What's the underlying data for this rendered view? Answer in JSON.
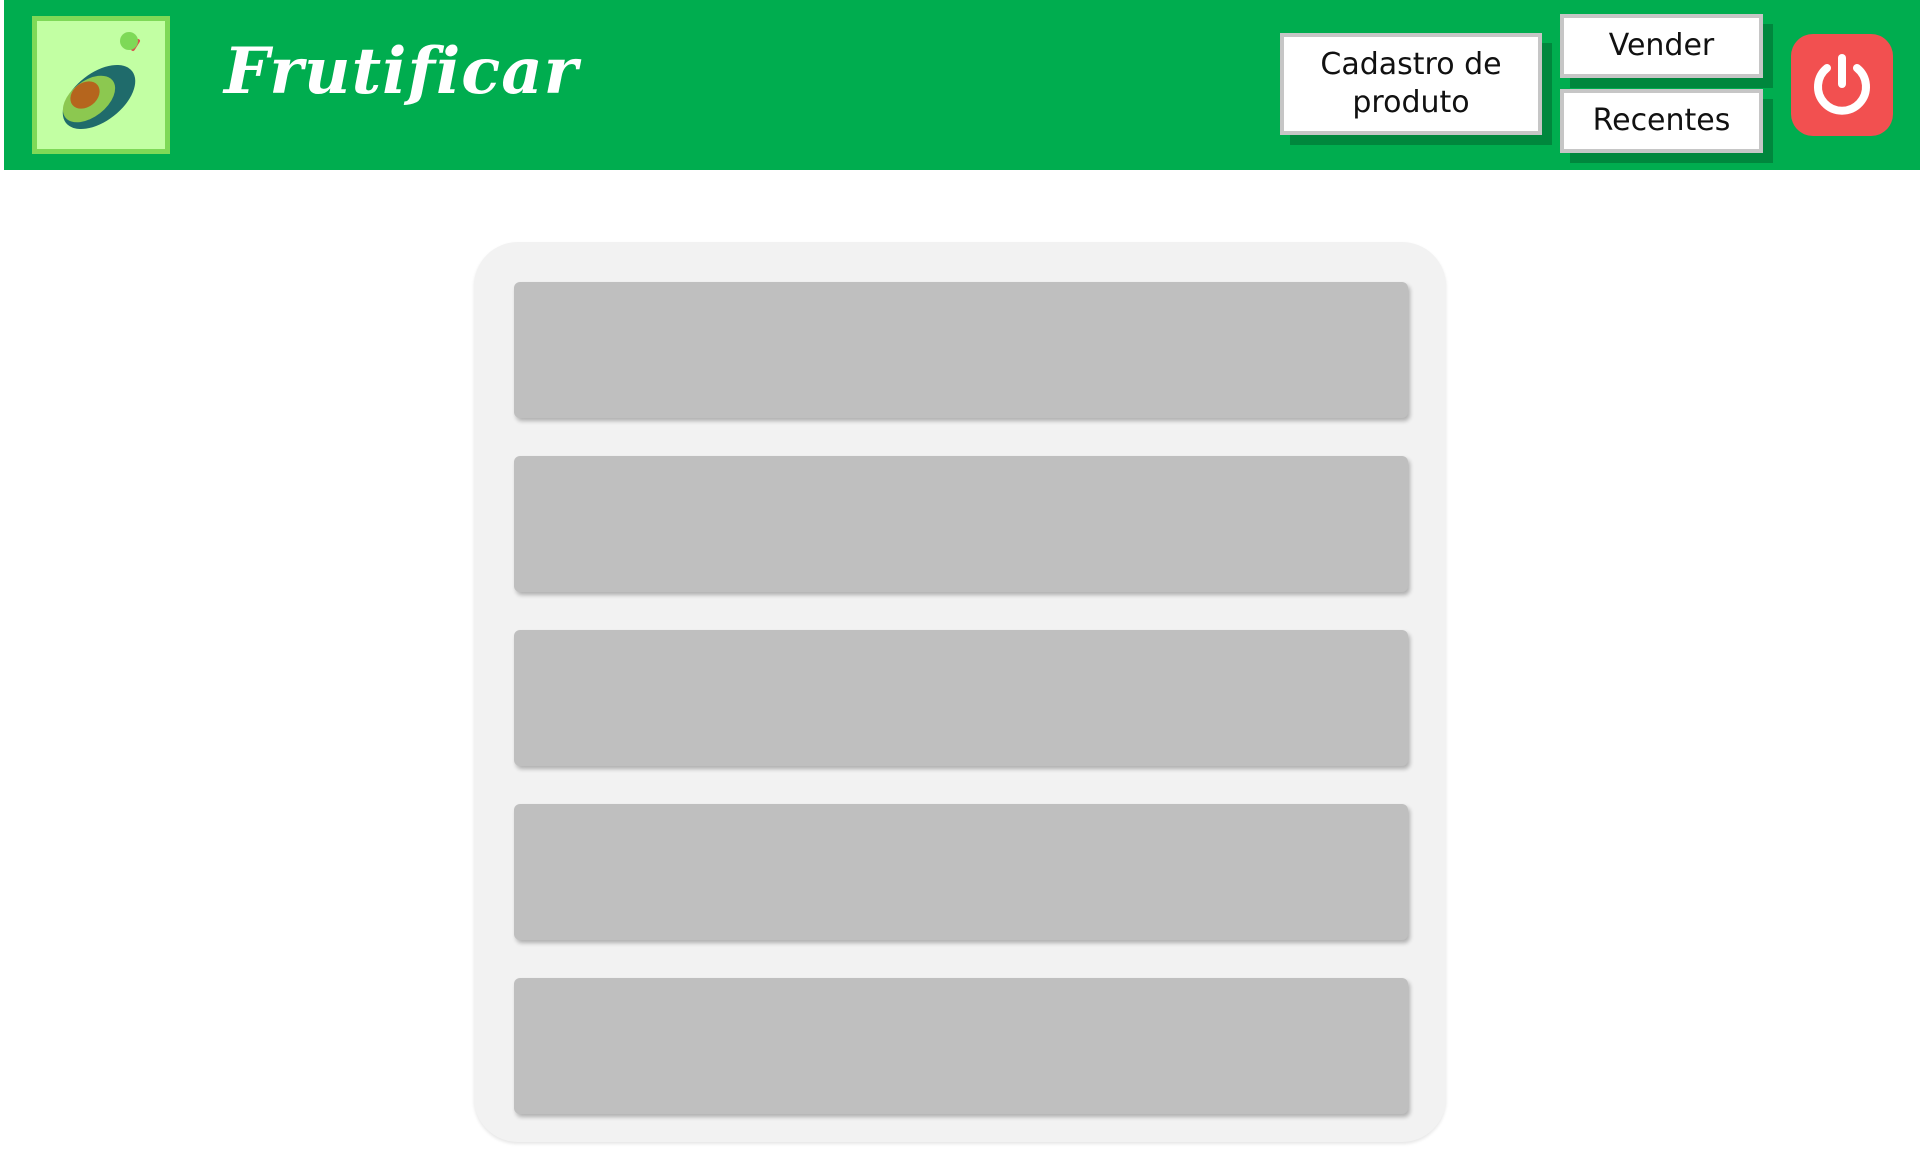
{
  "header": {
    "brand": "Frutificar",
    "background_color": "#00ad4f",
    "logo_icon": "avocado-icon"
  },
  "nav": {
    "cadastro_label": "Cadastro de produto",
    "vender_label": "Vender",
    "recentes_label": "Recentes",
    "logout_icon": "power-icon",
    "logout_color": "#f25050"
  },
  "main": {
    "list_items": [
      "",
      "",
      "",
      "",
      ""
    ]
  }
}
